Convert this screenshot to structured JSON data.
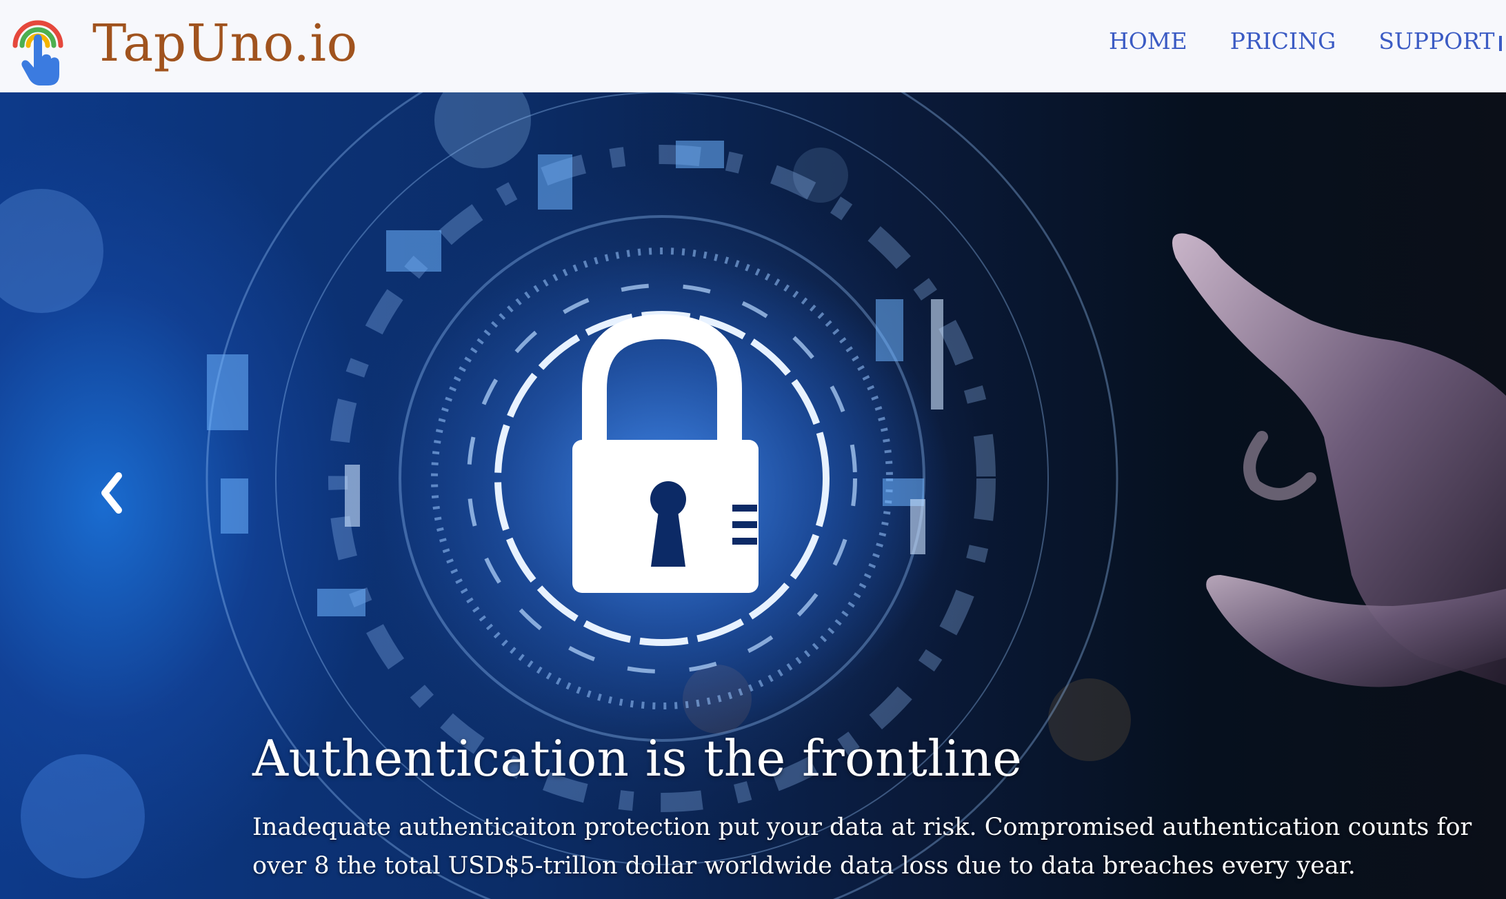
{
  "brand": {
    "name": "TapUno.io",
    "logo_icon": "tap-finger-rainbow-icon",
    "colors": {
      "name": "#a0531e"
    }
  },
  "nav": {
    "items": [
      {
        "label": "HOME"
      },
      {
        "label": "PRICING"
      },
      {
        "label": "SUPPORT"
      }
    ],
    "color": "#3b5bc4"
  },
  "hero": {
    "title": "Authentication is the frontline",
    "text": "Inadequate authenticaiton protection put your data at risk. Compromised authentication counts for over 8 the total USD$5-trillon dollar worldwide data loss due to data breaches every year.",
    "prev_icon": "chevron-left-icon",
    "image_icon": "padlock-icon",
    "colors": {
      "text": "#ffffff",
      "accent": "#1f5fbf"
    }
  }
}
